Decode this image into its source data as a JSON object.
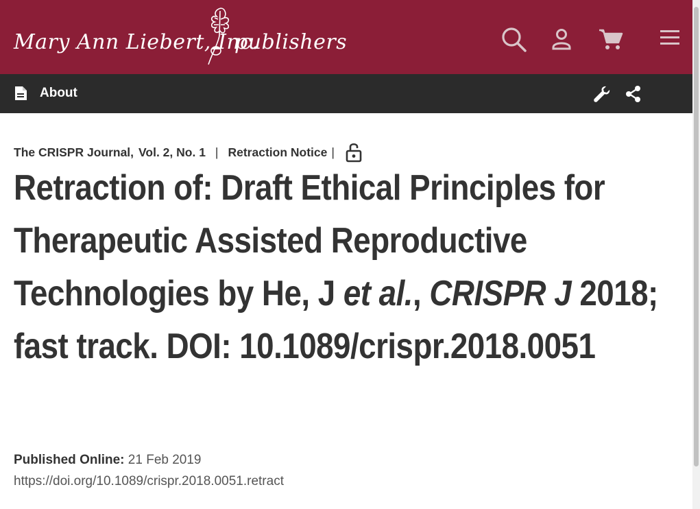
{
  "header": {
    "logo_name": "Mary Ann Liebert, Inc.",
    "logo_suffix": "publishers",
    "brand_color": "#8b1e37",
    "icons": [
      "search-icon",
      "account-icon",
      "cart-icon",
      "menu-icon"
    ]
  },
  "toolbar": {
    "about_label": "About",
    "icons": [
      "document-icon",
      "wrench-icon",
      "share-icon"
    ],
    "background": "#2b2b2b"
  },
  "article": {
    "journal": "The CRISPR Journal,",
    "volume": "Vol. 2, No. 1",
    "separator": "|",
    "type": "Retraction Notice",
    "type_separator": "|",
    "access_icon": "unlock-icon",
    "title_part1": "Retraction of: Draft Ethical Principles for Therapeutic Assisted Reproductive Technologies by He, J ",
    "title_italic1": "et al.",
    "title_part2": ", ",
    "title_italic2": "CRISPR J",
    "title_part3": " 2018; fast track. DOI: 10.1089/crispr.2018.0051",
    "published_label": "Published Online:",
    "published_date": "21 Feb 2019",
    "doi_url": "https://doi.org/10.1089/crispr.2018.0051.retract"
  }
}
